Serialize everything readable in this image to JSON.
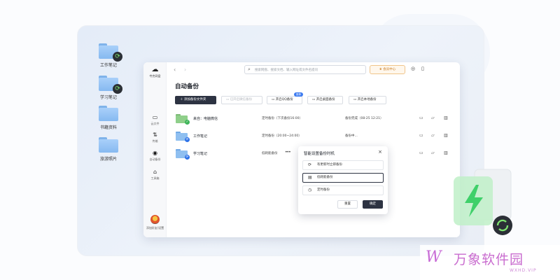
{
  "desktop": {
    "icons": [
      {
        "label": "工作笔记",
        "sync": true
      },
      {
        "label": "学习笔记",
        "sync": true
      },
      {
        "label": "书籍资料",
        "sync": false
      },
      {
        "label": "旅游照片",
        "sync": false
      }
    ]
  },
  "app": {
    "logo_text": "夸克网盘",
    "sidebar": [
      {
        "label": "云文件",
        "icon": "folder-icon"
      },
      {
        "label": "传输",
        "icon": "transfer-icon"
      },
      {
        "label": "自动备份",
        "icon": "backup-icon",
        "active": true
      },
      {
        "label": "工具箱",
        "icon": "toolbox-icon"
      }
    ],
    "avatar_label": "添加好友/设置",
    "search_placeholder": "搜索网盘、搜索文档、输入网址或文件名提问",
    "member_label": "会员中心",
    "page_title": "自动备份",
    "toolbar": {
      "add_folder": "添加备份文件夹",
      "wechat_backup": "已开启微信备份",
      "qq_backup": "开启QQ备份",
      "qq_badge": "推荐",
      "desktop_backup": "开启桌面备份",
      "local_backup": "开启本地备份"
    },
    "rows": [
      {
        "name": "来自：电脑微信",
        "mode": "定时备份（下次备份16:00）",
        "status": "备份完成（08-25 12:21）",
        "color": "#8fcf8a"
      },
      {
        "name": "工作笔记",
        "mode": "定时备份（20:00~24:00）",
        "status": "备份中...",
        "color": "#8fbff0"
      },
      {
        "name": "学习笔记",
        "mode": "低耗能备份",
        "status": "",
        "color": "#8fbff0"
      }
    ]
  },
  "popup": {
    "title": "智能设置备份时机",
    "options": [
      {
        "label": "有更新时立即备份",
        "selected": false
      },
      {
        "label": "低耗能备份",
        "selected": true
      },
      {
        "label": "定时备份",
        "selected": false
      }
    ],
    "reset_label": "重置",
    "confirm_label": "确定"
  },
  "watermark": {
    "logo": "W",
    "name": "万象软件园",
    "sub": "WXHD.VIP"
  }
}
